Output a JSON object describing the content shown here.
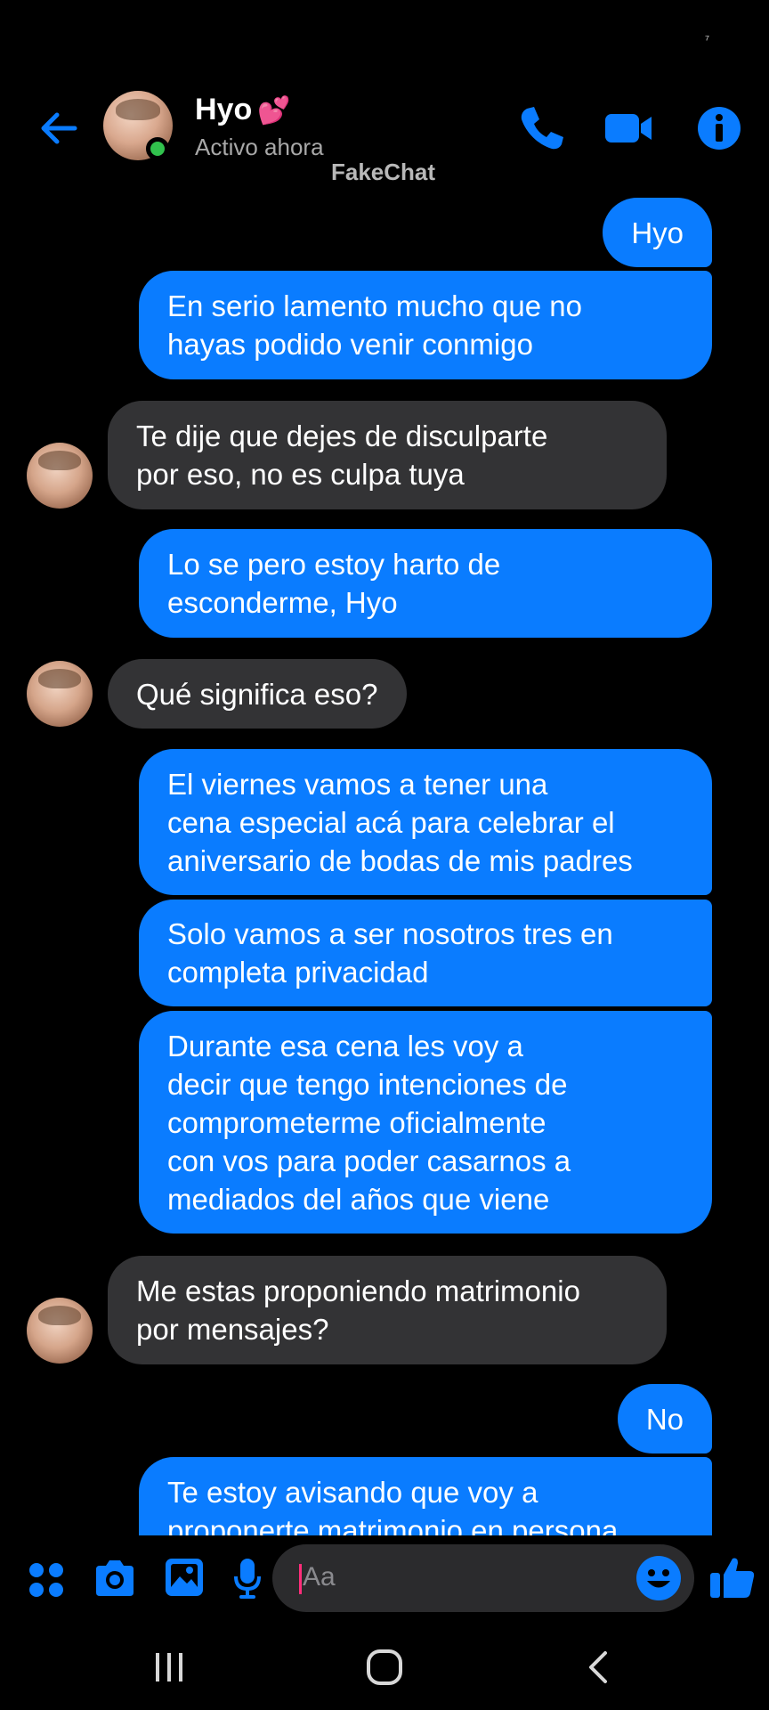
{
  "status_bar": {
    "glyph": "⁷"
  },
  "header": {
    "contact_name": "Hyo",
    "name_emoji": "💕",
    "presence": "Activo ahora",
    "watermark": "FakeChat",
    "icons": [
      "back-arrow-icon",
      "phone-icon",
      "video-camera-icon",
      "info-icon"
    ],
    "accent_color": "#0a7cff",
    "online_color": "#31c24d"
  },
  "messages": [
    {
      "from": "me",
      "text": "Hyo"
    },
    {
      "from": "me",
      "text": "En serio lamento mucho que no hayas podido venir conmigo"
    },
    {
      "from": "them",
      "text": "Te dije que dejes de disculparte por eso, no es culpa tuya"
    },
    {
      "from": "me",
      "text": "Lo se pero estoy harto de esconderme, Hyo"
    },
    {
      "from": "them",
      "text": "Qué significa eso?"
    },
    {
      "from": "me",
      "text": "El viernes vamos a tener una cena especial acá para celebrar el aniversario de bodas de mis padres"
    },
    {
      "from": "me",
      "text": "Solo vamos a ser nosotros tres en completa privacidad"
    },
    {
      "from": "me",
      "text": "Durante esa cena les voy a decir que tengo intenciones de comprometerme oficialmente con vos para poder casarnos a mediados del años que viene"
    },
    {
      "from": "them",
      "text": "Me estas proponiendo matrimonio por mensajes?"
    },
    {
      "from": "me",
      "text": "No"
    },
    {
      "from": "me",
      "text": "Te estoy avisando que voy a proponerte matrimonio en persona"
    }
  ],
  "composer": {
    "placeholder": "Aa",
    "icons": [
      "apps-grid-icon",
      "camera-icon",
      "gallery-icon",
      "microphone-icon",
      "emoji-icon",
      "thumbs-up-icon"
    ]
  },
  "navbar": {
    "icons": [
      "recents-icon",
      "home-icon",
      "back-icon"
    ]
  }
}
